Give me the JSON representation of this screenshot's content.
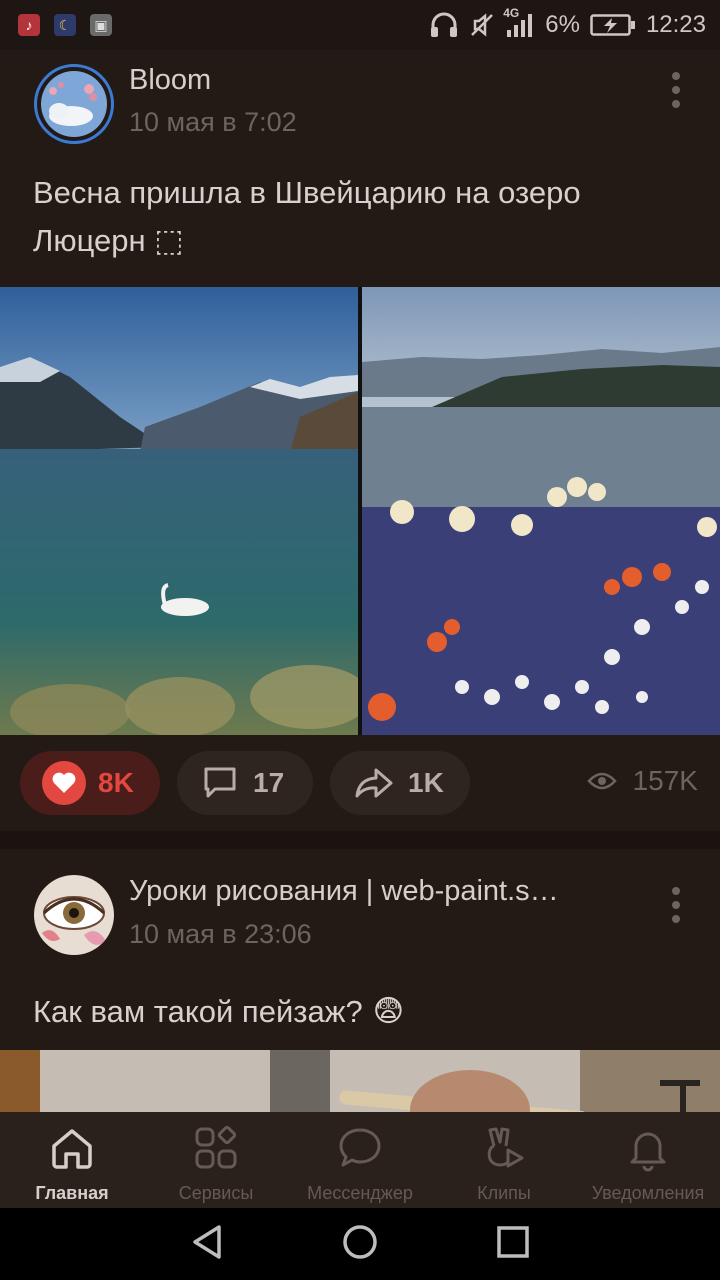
{
  "status_bar": {
    "network": "4G",
    "battery": "6%",
    "time": "12:23",
    "icons": [
      "music-icon",
      "moon-icon",
      "gallery-icon",
      "headphones-icon",
      "mute-icon",
      "signal-icon",
      "battery-charging-icon"
    ]
  },
  "posts": [
    {
      "author": "Bloom",
      "date": "10 мая в 7:02",
      "text": "Весна пришла в Швейцарию на озеро Люцерн ⬚",
      "likes": "8K",
      "comments": "17",
      "shares": "1K",
      "views": "157K"
    },
    {
      "author": "Уроки рисования | web-paint.s…",
      "date": "10 мая в 23:06",
      "text": "Как вам такой пейзаж?",
      "emoji": "😨"
    }
  ],
  "tabs": [
    {
      "label": "Главная",
      "icon": "home-icon",
      "active": true
    },
    {
      "label": "Сервисы",
      "icon": "services-icon",
      "active": false
    },
    {
      "label": "Мессенджер",
      "icon": "messenger-icon",
      "active": false
    },
    {
      "label": "Клипы",
      "icon": "clips-icon",
      "active": false
    },
    {
      "label": "Уведомления",
      "icon": "bell-icon",
      "active": false
    }
  ],
  "colors": {
    "background": "#231a16",
    "like_accent": "#e2483f",
    "avatar_ring": "#3a7bd5"
  }
}
